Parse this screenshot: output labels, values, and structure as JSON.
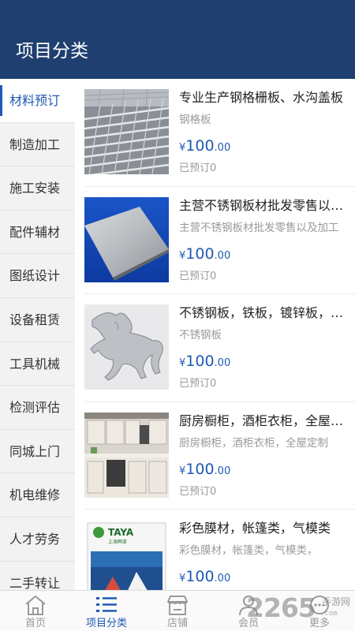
{
  "header": {
    "title": "项目分类"
  },
  "sidebar": {
    "items": [
      {
        "label": "材料预订",
        "active": true
      },
      {
        "label": "制造加工"
      },
      {
        "label": "施工安装"
      },
      {
        "label": "配件辅材"
      },
      {
        "label": "图纸设计"
      },
      {
        "label": "设备租赁"
      },
      {
        "label": "工具机械"
      },
      {
        "label": "检测评估"
      },
      {
        "label": "同城上门"
      },
      {
        "label": "机电维修"
      },
      {
        "label": "人才劳务"
      },
      {
        "label": "二手转让"
      }
    ]
  },
  "products": [
    {
      "title": "专业生产钢格栅板、水沟盖板",
      "subtitle": "钢格板",
      "currency": "¥",
      "price_int": "100",
      "price_dec": ".00",
      "booked": "已预订0",
      "image": "steel-grating"
    },
    {
      "title": "主营不锈钢板材批发零售以及加工",
      "subtitle": "主营不锈钢板材批发零售以及加工",
      "currency": "¥",
      "price_int": "100",
      "price_dec": ".00",
      "booked": "已预订0",
      "image": "stainless-plate"
    },
    {
      "title": "不锈钢板，铁板，镀锌板，铝板",
      "subtitle": "不锈钢板",
      "currency": "¥",
      "price_int": "100",
      "price_dec": ".00",
      "booked": "已预订0",
      "image": "horse-cutout"
    },
    {
      "title": "厨房橱柜，酒柜衣柜，全屋定制",
      "subtitle": "厨房橱柜，酒柜衣柜，全屋定制",
      "currency": "¥",
      "price_int": "100",
      "price_dec": ".00",
      "booked": "已预订0",
      "image": "kitchen-cabinet"
    },
    {
      "title": "彩色膜材，帐篷类，气模类",
      "subtitle": "彩色膜材，帐篷类，气模类，",
      "currency": "¥",
      "price_int": "100",
      "price_dec": ".00",
      "booked": "",
      "image": "membrane-brochure"
    }
  ],
  "brochure": {
    "brand": "TAYA",
    "cn": "上海鸭亚"
  },
  "tabbar": {
    "tabs": [
      {
        "label": "首页",
        "icon": "home-icon"
      },
      {
        "label": "项目分类",
        "icon": "list-icon",
        "active": true
      },
      {
        "label": "店铺",
        "icon": "store-icon"
      },
      {
        "label": "会员",
        "icon": "user-icon"
      },
      {
        "label": "更多",
        "icon": "more-icon"
      }
    ]
  },
  "watermark": {
    "number": "2265",
    "cn": "手游网",
    "en": ".com"
  },
  "colors": {
    "header": "#1e3f6f",
    "accent": "#1e5ab4"
  }
}
